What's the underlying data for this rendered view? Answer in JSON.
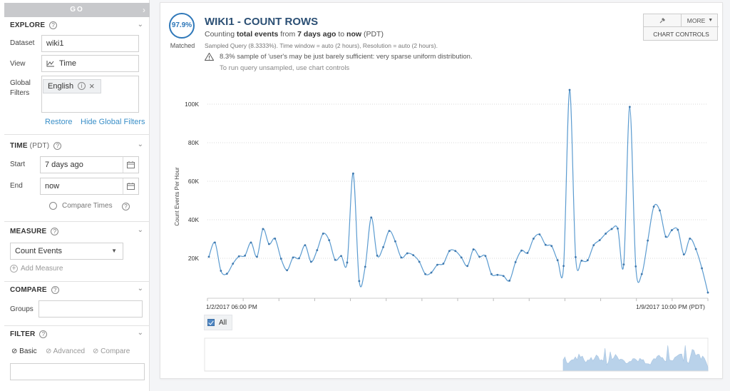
{
  "sidebar": {
    "go_label": "GO",
    "explore": {
      "heading": "EXPLORE",
      "dataset_label": "Dataset",
      "dataset_value": "wiki1",
      "view_label": "View",
      "view_value": "Time",
      "global_filters_label_1": "Global",
      "global_filters_label_2": "Filters",
      "filter_chip": "English",
      "restore_label": "Restore",
      "hide_filters_label": "Hide Global Filters"
    },
    "time": {
      "heading": "TIME",
      "heading_sub": "(PDT)",
      "start_label": "Start",
      "start_value": "7 days ago",
      "end_label": "End",
      "end_value": "now",
      "compare_times_label": "Compare Times"
    },
    "measure": {
      "heading": "MEASURE",
      "selected": "Count Events",
      "add_label": "Add Measure"
    },
    "compare": {
      "heading": "COMPARE",
      "groups_label": "Groups"
    },
    "filter": {
      "heading": "FILTER",
      "tabs": [
        "Basic",
        "Advanced",
        "Compare"
      ]
    }
  },
  "header": {
    "badge_value": "97.9%",
    "badge_label": "Matched",
    "title": "WIKI1 - COUNT ROWS",
    "subtitle_prefix": "Counting ",
    "subtitle_measure": "total events",
    "subtitle_from": " from ",
    "subtitle_start": "7 days ago",
    "subtitle_to": " to ",
    "subtitle_end": "now",
    "subtitle_tz": " (PDT)",
    "query_info": "Sampled Query (8.3333%).  Time window = auto (2 hours), Resolution = auto (2 hours).",
    "warning": "8.3% sample of 'user's may be just barely sufficient: very sparse uniform distribution.",
    "warning_sub": "To run query unsampled, use chart controls",
    "more_label": "MORE",
    "chart_controls_label": "CHART CONTROLS"
  },
  "colors": {
    "line": "#5b9bd0",
    "accent": "#2f78b9",
    "link": "#3a8fc8"
  },
  "chart_data": {
    "type": "line",
    "ylabel": "Count Events Per Hour",
    "xlabel": "",
    "yticks": [
      "20K",
      "40K",
      "60K",
      "80K",
      "100K"
    ],
    "ylim": [
      0,
      110000
    ],
    "x_start_label": "1/2/2017 06:00 PM",
    "x_end_label": "1/9/2017 10:00 PM (PDT)",
    "grid": true,
    "legend": [
      "All"
    ],
    "series": [
      {
        "name": "All",
        "values": [
          20800,
          28200,
          13500,
          12000,
          17200,
          21000,
          21400,
          28200,
          20800,
          35200,
          27400,
          30200,
          19800,
          13800,
          20400,
          20000,
          26800,
          18200,
          24200,
          32800,
          29400,
          19200,
          21200,
          17800,
          64000,
          8200,
          15600,
          41200,
          21400,
          25800,
          34200,
          28800,
          20400,
          22600,
          21600,
          18200,
          11800,
          12600,
          16600,
          17200,
          23800,
          23800,
          20400,
          16000,
          24600,
          20800,
          21200,
          11800,
          11400,
          10800,
          8400,
          18000,
          24000,
          22800,
          30200,
          32400,
          27000,
          26400,
          19000,
          16000,
          107400,
          20600,
          18800,
          19000,
          26800,
          29400,
          32800,
          35200,
          35400,
          16800,
          98600,
          15800,
          11800,
          29200,
          46800,
          44800,
          31200,
          34600,
          34800,
          22000,
          30200,
          24800,
          14800,
          2200
        ]
      }
    ]
  }
}
